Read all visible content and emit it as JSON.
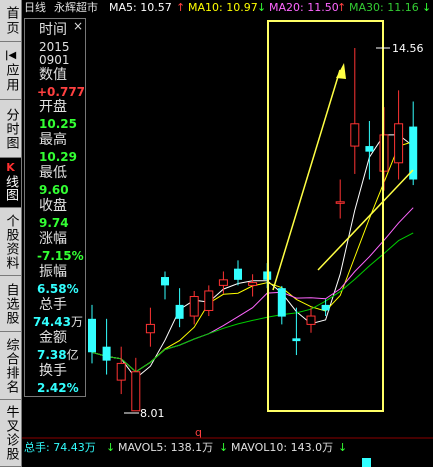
{
  "header": {
    "period": "日线",
    "stock_name": "永辉超市",
    "ma5": {
      "label": "MA5: 10.57",
      "arrow": "↑",
      "color": "#ffffff"
    },
    "ma10": {
      "label": "MA10: 10.97",
      "arrow": "↓",
      "color": "#ffff00"
    },
    "ma20": {
      "label": "MA20: 11.50",
      "arrow": "↑",
      "color": "#ff66ff"
    },
    "ma30": {
      "label": "MA30: 11.16",
      "arrow": "↓",
      "color": "#00cc00"
    }
  },
  "tabs": [
    {
      "label": "首页",
      "active": false
    },
    {
      "label": "应用",
      "active": false,
      "marker": "|◀"
    },
    {
      "label": "分时图",
      "active": false
    },
    {
      "label": "K线图",
      "active": true,
      "marker": "K"
    },
    {
      "label": "个股资料",
      "active": false
    },
    {
      "label": "自选股",
      "active": false
    },
    {
      "label": "综合排名",
      "active": false
    },
    {
      "label": "牛叉诊股",
      "active": false
    }
  ],
  "info_panel": {
    "close": "×",
    "time_label": "时间",
    "year": "2015",
    "date": "0901",
    "value_label": "数值",
    "value": "+0.777",
    "open_label": "开盘",
    "open": "10.25",
    "high_label": "最高",
    "high": "10.29",
    "low_label": "最低",
    "low": "9.60",
    "close_label": "收盘",
    "close_value": "9.74",
    "change_label": "涨幅",
    "change": "-7.15%",
    "amplitude_label": "振幅",
    "amplitude": "6.58%",
    "volume_label": "总手",
    "volume_num": "74.43",
    "volume_unit": "万",
    "amount_label": "金额",
    "amount_num": "7.38",
    "amount_unit": "亿",
    "turnover_label": "换手",
    "turnover": "2.42%"
  },
  "chart_labels": {
    "max_price": "14.56",
    "min_price": "8.01",
    "marker": "q"
  },
  "footer": {
    "volume": "总手: 74.43万",
    "volume_arrow": "↓",
    "mavol5": "MAVOL5: 138.1万",
    "mavol5_arrow": "↓",
    "mavol10": "MAVOL10: 143.0万",
    "mavol10_arrow": "↓"
  },
  "colors": {
    "up": "#ff3333",
    "down": "#33ffff",
    "highlight_box": "#ffff66",
    "value_red": "#ff4040",
    "value_green": "#33ff33",
    "value_cyan": "#33ffff"
  },
  "chart_data": {
    "type": "candlestick",
    "title": "永辉超市 日线",
    "candles": [
      {
        "o": 9.7,
        "h": 9.95,
        "l": 8.9,
        "c": 9.1,
        "dir": "down"
      },
      {
        "o": 9.2,
        "h": 9.7,
        "l": 8.7,
        "c": 8.95,
        "dir": "down"
      },
      {
        "o": 8.6,
        "h": 9.2,
        "l": 8.35,
        "c": 8.9,
        "dir": "up"
      },
      {
        "o": 8.75,
        "h": 9.0,
        "l": 8.05,
        "c": 8.05,
        "dir": "up"
      },
      {
        "o": 9.45,
        "h": 9.9,
        "l": 9.2,
        "c": 9.6,
        "dir": "up"
      },
      {
        "o": 10.45,
        "h": 10.55,
        "l": 10.05,
        "c": 10.3,
        "dir": "down"
      },
      {
        "o": 9.95,
        "h": 10.25,
        "l": 9.55,
        "c": 9.7,
        "dir": "down"
      },
      {
        "o": 9.75,
        "h": 10.2,
        "l": 9.6,
        "c": 10.1,
        "dir": "up"
      },
      {
        "o": 9.85,
        "h": 10.3,
        "l": 9.75,
        "c": 10.2,
        "dir": "up"
      },
      {
        "o": 10.3,
        "h": 10.55,
        "l": 10.15,
        "c": 10.4,
        "dir": "up"
      },
      {
        "o": 10.6,
        "h": 10.75,
        "l": 10.3,
        "c": 10.4,
        "dir": "down"
      },
      {
        "o": 10.3,
        "h": 10.5,
        "l": 10.1,
        "c": 10.35,
        "dir": "up"
      },
      {
        "o": 10.55,
        "h": 10.7,
        "l": 10.25,
        "c": 10.4,
        "dir": "down"
      },
      {
        "o": 10.25,
        "h": 10.29,
        "l": 9.6,
        "c": 9.74,
        "dir": "down"
      },
      {
        "o": 9.3,
        "h": 9.9,
        "l": 9.05,
        "c": 9.35,
        "dir": "down"
      },
      {
        "o": 9.6,
        "h": 9.9,
        "l": 9.45,
        "c": 9.75,
        "dir": "up"
      },
      {
        "o": 9.85,
        "h": 10.05,
        "l": 9.75,
        "c": 9.95,
        "dir": "down"
      },
      {
        "o": 11.8,
        "h": 12.2,
        "l": 11.5,
        "c": 11.8,
        "dir": "up"
      },
      {
        "o": 12.8,
        "h": 14.56,
        "l": 12.3,
        "c": 13.2,
        "dir": "up"
      },
      {
        "o": 12.7,
        "h": 13.25,
        "l": 12.2,
        "c": 12.8,
        "dir": "down"
      },
      {
        "o": 12.35,
        "h": 13.5,
        "l": 12.0,
        "c": 13.0,
        "dir": "up"
      },
      {
        "o": 12.5,
        "h": 13.8,
        "l": 12.2,
        "c": 13.2,
        "dir": "up"
      },
      {
        "o": 13.15,
        "h": 13.6,
        "l": 12.1,
        "c": 12.2,
        "dir": "down"
      }
    ],
    "price_max": 14.56,
    "price_min": 8.01
  }
}
